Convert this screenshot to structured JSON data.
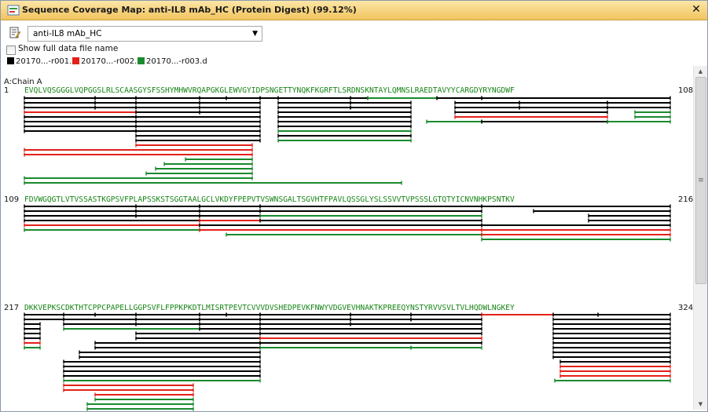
{
  "window": {
    "title": "Sequence Coverage Map: anti-IL8 mAb_HC (Protein Digest) (99.12%)",
    "close_glyph": "✕",
    "app_icon": "sequence-map-icon"
  },
  "selector": {
    "value": "anti-IL8 mAb_HC",
    "arrow": "▼",
    "icon": "document-edit-icon"
  },
  "checkbox": {
    "label": "Show full data file name",
    "checked": false
  },
  "legend": [
    {
      "label": "20170...-r001.d",
      "color": "#000000"
    },
    {
      "label": "20170...-r002.d",
      "color": "#e32119"
    },
    {
      "label": "20170...-r003.d",
      "color": "#1a8a2e"
    }
  ],
  "chain_label": "A:Chain A",
  "rows": [
    {
      "start": "1",
      "end": "108",
      "sequence": "EVQLVQSGGGLVQPGGSLRLSCAASGYSFSSHYMHWVRQAPGKGLEWVGYIDPSNGETTYNQKFKGRFTLSRDNSKNTAYLQMNSLRAEDTAVYYCARGDYRYNGDWF"
    },
    {
      "start": "109",
      "end": "216",
      "sequence": "FDVWGQGTLVTVSSASTKGPSVFPLAPSSKSTSGGTAALGCLVKDYFPEPVTVSWNSGALTSGVHTFPAVLQSSGLYSLSSVVTVPSSSLGTQTYICNVNHKPSNTKV"
    },
    {
      "start": "217",
      "end": "324",
      "sequence": "DKKVEPKSCDKTHTCPPCPAPELLGGPSVFLFPPKPKDTLMISRTPEVTCVVVDVSHEDPEVKFNWYVDGVEVHNAKTKPREEQYNSTYRVVSVLTVLHQDWLNGKEY"
    }
  ],
  "colors": {
    "black": "#000000",
    "red": "#e32119",
    "green": "#1a8a2e",
    "sequence_text": "#178517"
  },
  "scrollbar": {
    "up": "▲",
    "down": "▼",
    "grip": "≡"
  }
}
